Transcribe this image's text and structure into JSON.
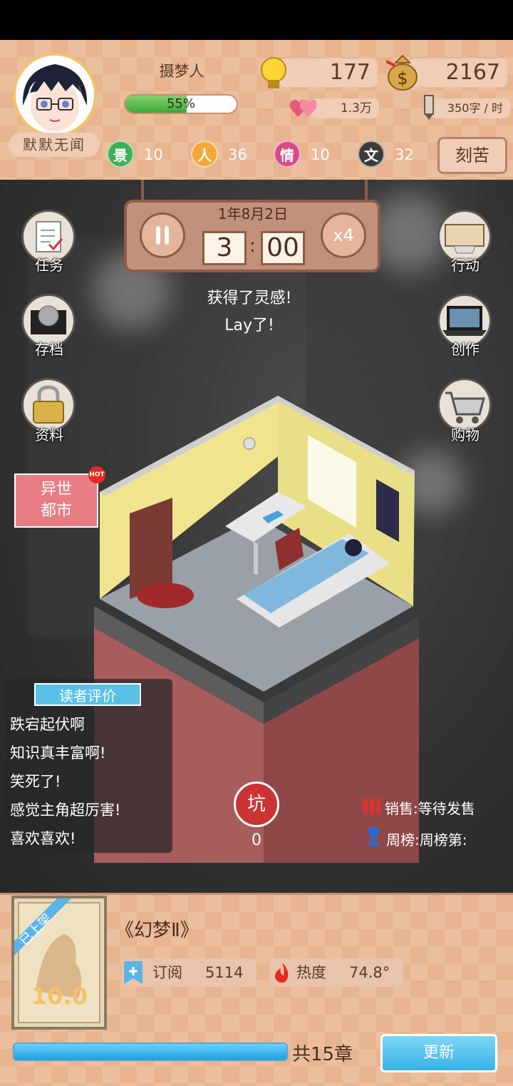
{
  "player": {
    "name": "默默无闻",
    "level_title": "摄梦人",
    "exp_percent": "55%",
    "exp_fraction": 0.55
  },
  "resources": {
    "inspiration": "177",
    "money": "2167",
    "fans": "1.3万",
    "speed": "350字 / 时"
  },
  "attributes": [
    {
      "icon": "景",
      "value": "10",
      "color": "#3eb05a"
    },
    {
      "icon": "人",
      "value": "36",
      "color": "#f3a83b"
    },
    {
      "icon": "情",
      "value": "10",
      "color": "#d94a86"
    },
    {
      "icon": "文",
      "value": "32",
      "color": "#3b3b3b"
    }
  ],
  "ku_button": "刻苦",
  "clock": {
    "date": "1年8月2日",
    "hour": "3",
    "minute": "00",
    "pause_icon": "pause-icon",
    "speed_label": "x4"
  },
  "messages": [
    "获得了灵感!",
    "Lay了!"
  ],
  "left_menu": [
    {
      "label": "任务",
      "icon": "task-icon"
    },
    {
      "label": "存档",
      "icon": "save-icon"
    },
    {
      "label": "资料",
      "icon": "lock-icon"
    }
  ],
  "right_menu": [
    {
      "label": "行动",
      "icon": "action-icon"
    },
    {
      "label": "创作",
      "icon": "create-icon"
    },
    {
      "label": "购物",
      "icon": "cart-icon"
    }
  ],
  "event": {
    "line1": "异世",
    "line2": "都市",
    "badge": "HOT"
  },
  "reviews": {
    "title": "读者评价",
    "items": [
      "跌宕起伏啊",
      "知识真丰富啊!",
      "笑死了!",
      "感觉主角超厉害!",
      "喜欢喜欢!"
    ]
  },
  "pit": {
    "label": "坑",
    "count": "0"
  },
  "sales": {
    "label": "销售:等待发售"
  },
  "weekly": {
    "label": "周榜:周榜第:"
  },
  "book": {
    "status": "已上架",
    "title": "《幻梦Ⅱ》",
    "score": "10.0",
    "subscribe_label": "订阅",
    "subscribe_value": "5114",
    "heat_label": "热度",
    "heat_value": "74.8°"
  },
  "chapter": {
    "text": "共15章",
    "progress_fraction": 1.0
  },
  "update_button": "更新",
  "colors": {
    "accent": "#38b2e6",
    "panel": "#e7b48f",
    "brown": "#8d5d47"
  }
}
